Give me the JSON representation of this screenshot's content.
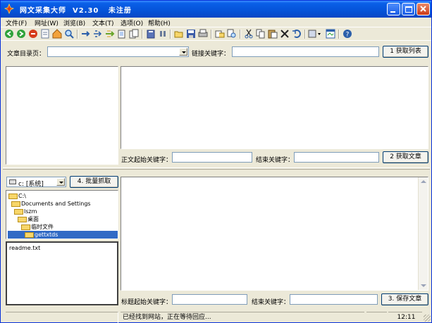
{
  "window": {
    "title": "网文采集大师  V2.30   未注册",
    "controls": [
      "minimize",
      "maximize",
      "close"
    ]
  },
  "menu": {
    "items": [
      "文件(F)",
      "网址(W)",
      "浏览(B)",
      "文本(T)",
      "选项(O)",
      "帮助(H)"
    ]
  },
  "toolbar": {
    "icons": [
      "back-icon",
      "forward-icon",
      "stop-icon",
      "refresh-icon",
      "home-icon",
      "search-icon",
      "arrow-right-icon",
      "jump-icon",
      "next-icon",
      "copy-page-icon",
      "pages-icon",
      "book-icon",
      "pause-icon",
      "open-folder-icon",
      "save-icon",
      "print-icon",
      "tag-icon",
      "find-icon",
      "cut-icon",
      "copy-icon",
      "paste-icon",
      "delete-icon",
      "undo-icon",
      "tools-icon",
      "window-icon",
      "help-icon"
    ]
  },
  "catalog": {
    "label": "文章目录页：",
    "value": "",
    "link_key_label": "链接关键字：",
    "link_key_value": "",
    "fetch_list_button": "1 获取列表"
  },
  "article": {
    "start_key_label": "正文起始关键字：",
    "start_key_value": "",
    "end_key_label": "结束关键字：",
    "end_key_value": "",
    "fetch_article_button": "2 获取文章"
  },
  "drive": {
    "selected": "c: [系统]",
    "batch_button": "4. 批量抓取"
  },
  "tree": {
    "nodes": [
      {
        "label": "C:\\",
        "level": 0,
        "selected": false
      },
      {
        "label": "Documents and Settings",
        "level": 1,
        "selected": false
      },
      {
        "label": "lszm",
        "level": 2,
        "selected": false
      },
      {
        "label": "桌面",
        "level": 3,
        "selected": false
      },
      {
        "label": "临时文件",
        "level": 4,
        "selected": false
      },
      {
        "label": "gettxtds",
        "level": 5,
        "selected": true
      }
    ]
  },
  "files": {
    "items": [
      "readme.txt"
    ]
  },
  "save": {
    "title_start_label": "标题起始关键字：",
    "title_start_value": "",
    "end_key_label": "结束关键字：",
    "end_key_value": "",
    "save_button": "3. 保存文章"
  },
  "status": {
    "message": "已经找到网站，正在等待回应...",
    "time": "12:11"
  },
  "colors": {
    "titlebar": "#0553d8",
    "face": "#ece9d8",
    "selection": "#316ac5"
  }
}
